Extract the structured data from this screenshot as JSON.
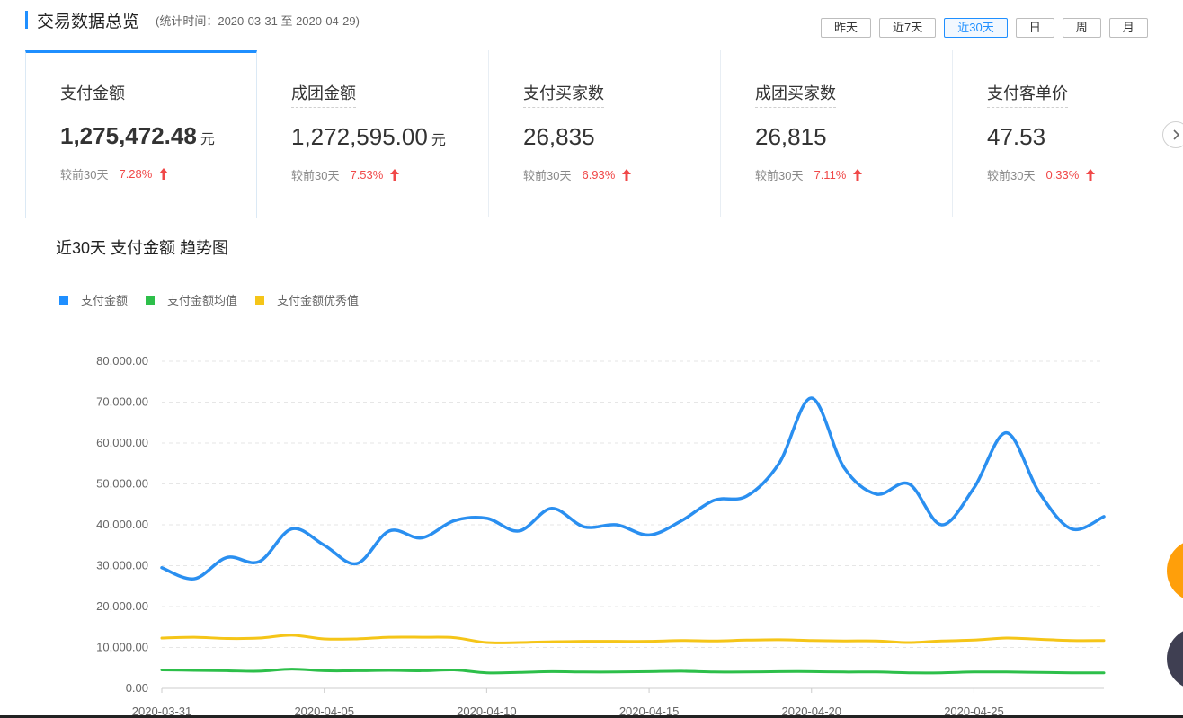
{
  "header": {
    "title": "交易数据总览",
    "range": "(统计时间：2020-03-31 至 2020-04-29)"
  },
  "periods": [
    {
      "label": "昨天",
      "active": false
    },
    {
      "label": "近7天",
      "active": false
    },
    {
      "label": "近30天",
      "active": true
    },
    {
      "label": "日",
      "active": false
    },
    {
      "label": "周",
      "active": false
    },
    {
      "label": "月",
      "active": false
    }
  ],
  "metrics": [
    {
      "name": "支付金额",
      "value": "1,275,472.48",
      "unit": "元",
      "compare_label": "较前30天",
      "pct": "7.28%"
    },
    {
      "name": "成团金额",
      "value": "1,272,595.00",
      "unit": "元",
      "compare_label": "较前30天",
      "pct": "7.53%"
    },
    {
      "name": "支付买家数",
      "value": "26,835",
      "unit": "",
      "compare_label": "较前30天",
      "pct": "6.93%"
    },
    {
      "name": "成团买家数",
      "value": "26,815",
      "unit": "",
      "compare_label": "较前30天",
      "pct": "7.11%"
    },
    {
      "name": "支付客单价",
      "value": "47.53",
      "unit": "",
      "compare_label": "较前30天",
      "pct": "0.33%"
    }
  ],
  "colors": {
    "accent": "#1f8fff",
    "up": "#f04848",
    "avg": "#2dbf4a",
    "excellent": "#f5c518"
  },
  "chart_title": "近30天 支付金额 趋势图",
  "chart_data": {
    "type": "line",
    "title": "近30天 支付金额 趋势图",
    "legend_position": "top-left",
    "grid": true,
    "ylim": [
      0,
      80000
    ],
    "yticks": [
      "0.00",
      "10,000.00",
      "20,000.00",
      "30,000.00",
      "40,000.00",
      "50,000.00",
      "60,000.00",
      "70,000.00",
      "80,000.00"
    ],
    "xtick_labels": [
      "2020-03-31",
      "2020-04-05",
      "2020-04-10",
      "2020-04-15",
      "2020-04-20",
      "2020-04-25"
    ],
    "x": [
      "2020-03-31",
      "2020-04-01",
      "2020-04-02",
      "2020-04-03",
      "2020-04-04",
      "2020-04-05",
      "2020-04-06",
      "2020-04-07",
      "2020-04-08",
      "2020-04-09",
      "2020-04-10",
      "2020-04-11",
      "2020-04-12",
      "2020-04-13",
      "2020-04-14",
      "2020-04-15",
      "2020-04-16",
      "2020-04-17",
      "2020-04-18",
      "2020-04-19",
      "2020-04-20",
      "2020-04-21",
      "2020-04-22",
      "2020-04-23",
      "2020-04-24",
      "2020-04-25",
      "2020-04-26",
      "2020-04-27",
      "2020-04-28",
      "2020-04-29"
    ],
    "series": [
      {
        "name": "支付金额",
        "color": "#2a8ff0",
        "values": [
          29500,
          26800,
          32000,
          31000,
          39000,
          35000,
          30500,
          38500,
          36800,
          41000,
          41600,
          38500,
          44000,
          39500,
          40000,
          37500,
          41000,
          46000,
          47000,
          55000,
          71000,
          54000,
          47500,
          50000,
          40000,
          49000,
          62500,
          48000,
          39000,
          42000
        ]
      },
      {
        "name": "支付金额均值",
        "color": "#2dbf4a",
        "values": [
          4500,
          4400,
          4300,
          4200,
          4700,
          4300,
          4300,
          4400,
          4300,
          4500,
          3800,
          3900,
          4100,
          4000,
          4000,
          4100,
          4200,
          4000,
          4000,
          4100,
          4100,
          4000,
          4000,
          3800,
          3800,
          4000,
          4000,
          3900,
          3800,
          3800
        ]
      },
      {
        "name": "支付金额优秀值",
        "color": "#f5c518",
        "values": [
          12300,
          12500,
          12200,
          12300,
          13000,
          12100,
          12100,
          12500,
          12500,
          12400,
          11200,
          11200,
          11400,
          11500,
          11500,
          11500,
          11700,
          11600,
          11800,
          11900,
          11700,
          11600,
          11600,
          11200,
          11600,
          11800,
          12300,
          12000,
          11700,
          11700
        ]
      }
    ]
  }
}
